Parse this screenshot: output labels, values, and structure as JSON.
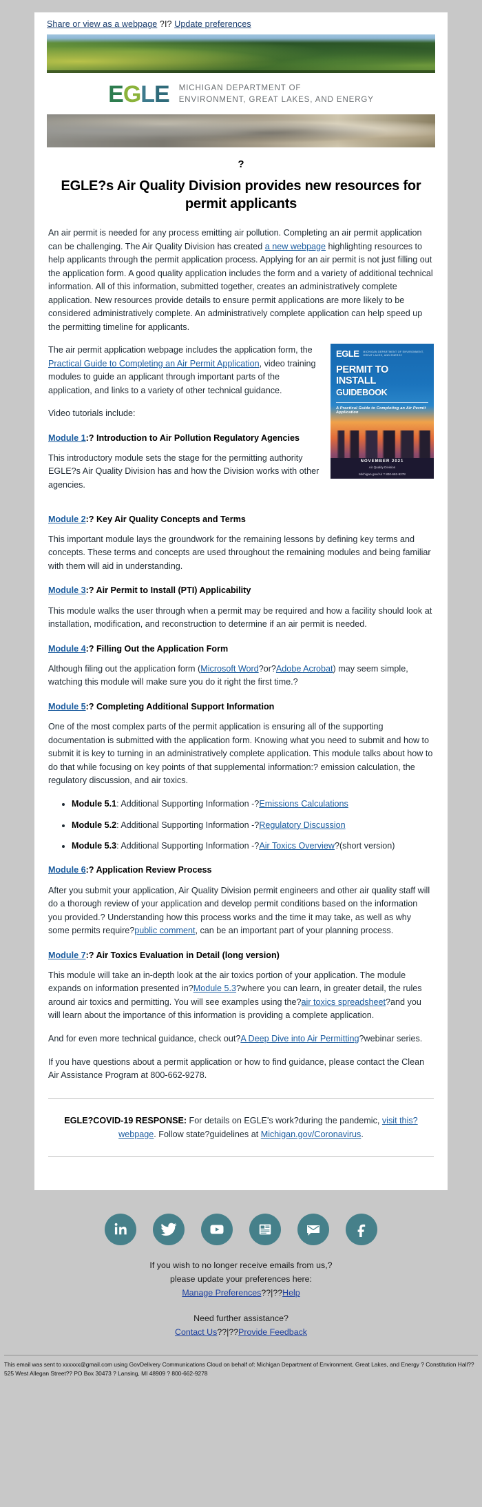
{
  "preheader": {
    "share_link": "Share or view as a webpage",
    "separator": "?I?",
    "update_link": "Update preferences"
  },
  "brand": {
    "logo_text": "EGLE",
    "dept_line1": "MICHIGAN DEPARTMENT OF",
    "dept_line2": "ENVIRONMENT, GREAT LAKES, AND ENERGY"
  },
  "article": {
    "pre_title_marker": "?",
    "headline": "EGLE?s Air Quality Division provides new resources for permit applicants",
    "intro_p1_a": "An air permit is needed for any process emitting air pollution. Completing an air permit application can be challenging. The Air Quality Division has created ",
    "intro_link": "a new webpage",
    "intro_p1_b": " highlighting resources to help applicants through the permit application process. Applying for an air permit is not just filling out the application form. A good quality application includes the form and a variety of additional technical information. All of this information, submitted together, creates an administratively complete application. New resources provide details to ensure permit applications are more likely to be considered administratively complete. An administratively complete application can help speed up the permitting timeline for applicants.",
    "webpage_p_a": "The air permit application webpage includes the application form, the ",
    "webpage_link": "Practical Guide to Completing an Air Permit Application",
    "webpage_p_b": ", video training modules to guide an applicant through important parts of the application, and links to a variety of other technical guidance.",
    "video_intro": "Video tutorials include:"
  },
  "guidebook": {
    "logo": "EGLE",
    "dept": "MICHIGAN DEPARTMENT OF ENVIRONMENT, GREAT LAKES, AND ENERGY",
    "title_line1": "PERMIT TO INSTALL",
    "title_line2": "GUIDEBOOK",
    "subtitle": "A Practical Guide to Completing an Air Permit Application",
    "date": "NOVEMBER 2021",
    "division": "Air Quality Division",
    "division_contact": "Michigan.gov/Air  ?  800-662-9278"
  },
  "modules": [
    {
      "id": "module-1",
      "link": "Module 1",
      "title_rest": ":? Introduction to Air Pollution Regulatory Agencies",
      "body": "This introductory module sets the stage for the permitting authority EGLE?s Air Quality Division has and how the Division works with other agencies."
    },
    {
      "id": "module-2",
      "link": "Module 2",
      "title_rest": ":? Key Air Quality Concepts and Terms",
      "body": "This important module lays the groundwork for the remaining lessons by defining key terms and concepts. These terms and concepts are used throughout the remaining modules and being familiar with them will aid in understanding."
    },
    {
      "id": "module-3",
      "link": "Module 3",
      "title_rest": ":? Air Permit to Install (PTI) Applicability",
      "body": "This module walks the user through when a permit may be required and how a facility should look at installation, modification, and reconstruction to determine if an air permit is needed."
    },
    {
      "id": "module-4",
      "link": "Module 4",
      "title_rest": ":? Filling Out the Application Form",
      "body_a": "Although filing out the application form (",
      "body_link1": "Microsoft Word",
      "body_mid": "?or?",
      "body_link2": "Adobe Acrobat",
      "body_b": ") may seem simple, watching this module will make sure you do it right the first time.?"
    },
    {
      "id": "module-5",
      "link": "Module 5",
      "title_rest": ":? Completing Additional Support Information",
      "body": "One of the most complex parts of the permit application is ensuring all of the supporting documentation is submitted with the application form. Knowing what you need to submit and how to submit it is key to turning in an administratively complete application. This module talks about how to do that while focusing on key points of that supplemental information:? emission calculation, the regulatory discussion, and air toxics."
    },
    {
      "id": "module-6",
      "link": "Module 6",
      "title_rest": ":? Application Review Process",
      "body_a": "After you submit your application, Air Quality Division permit engineers and other air quality staff will do a thorough review of your application and develop permit conditions based on the information you provided.? Understanding how this process works and the time it may take, as well as why some permits require?",
      "body_link": "public comment",
      "body_b": ", can be an important part of your planning process."
    },
    {
      "id": "module-7",
      "link": "Module 7",
      "title_rest": ":? Air Toxics Evaluation in Detail (long version)",
      "body_a": "This module will take an in-depth look at the air toxics portion of your application. The module expands on information presented in?",
      "body_link1": "Module 5.3",
      "body_mid": "?where you can learn, in greater detail, the rules around air toxics and permitting. You will see examples using the?",
      "body_link2": "air toxics spreadsheet",
      "body_b": "?and you will learn about the importance of this information is providing a complete application."
    }
  ],
  "sublist": [
    {
      "label": "Module 5.1",
      "text": ": Additional Supporting Information -?",
      "link": "Emissions Calculations",
      "suffix": ""
    },
    {
      "label": "Module 5.2",
      "text": ": Additional Supporting Information -?",
      "link": "Regulatory Discussion",
      "suffix": ""
    },
    {
      "label": "Module 5.3",
      "text": ": Additional Supporting Information -?",
      "link": "Air Toxics Overview",
      "suffix": "?(short version)"
    }
  ],
  "closing": {
    "deep_dive_a": "And for even more technical guidance, check out?",
    "deep_dive_link": "A Deep Dive into Air Permitting",
    "deep_dive_b": "?webinar series.",
    "contact": "If you have questions about a permit application or how to find guidance, please contact the Clean Air Assistance Program at 800-662-9278."
  },
  "covid": {
    "heading": "EGLE?COVID-19 RESPONSE:",
    "text_a": " For details on EGLE's work?during the pandemic, ",
    "link1": "visit this?webpage",
    "text_b": ". Follow state?guidelines at ",
    "link2": "Michigan.gov/Coronavirus",
    "text_c": "."
  },
  "footer": {
    "social": [
      {
        "name": "linkedin-icon",
        "label": "LinkedIn"
      },
      {
        "name": "twitter-icon",
        "label": "Twitter"
      },
      {
        "name": "youtube-icon",
        "label": "YouTube"
      },
      {
        "name": "newsletter-icon",
        "label": "Newsletter"
      },
      {
        "name": "email-icon",
        "label": "Email"
      },
      {
        "name": "facebook-icon",
        "label": "Facebook"
      }
    ],
    "unsub_line1": "If you wish to no longer receive emails from us,?",
    "unsub_line2": "please update your preferences here:",
    "manage_link": "Manage Preferences",
    "manage_sep": "??|??",
    "help_link": "Help",
    "assist_line": "Need further assistance?",
    "contact_link": "Contact Us",
    "contact_sep": "??|??",
    "feedback_link": "Provide Feedback",
    "fineprint": "This email was sent to xxxxxx@gmail.com using GovDelivery Communications Cloud on behalf of: Michigan Department of Environment, Great Lakes, and Energy ? Constitution Hall?? 525 West Allegan Street?? PO Box 30473 ? Lansing, MI 48909 ? 800-662-9278"
  }
}
